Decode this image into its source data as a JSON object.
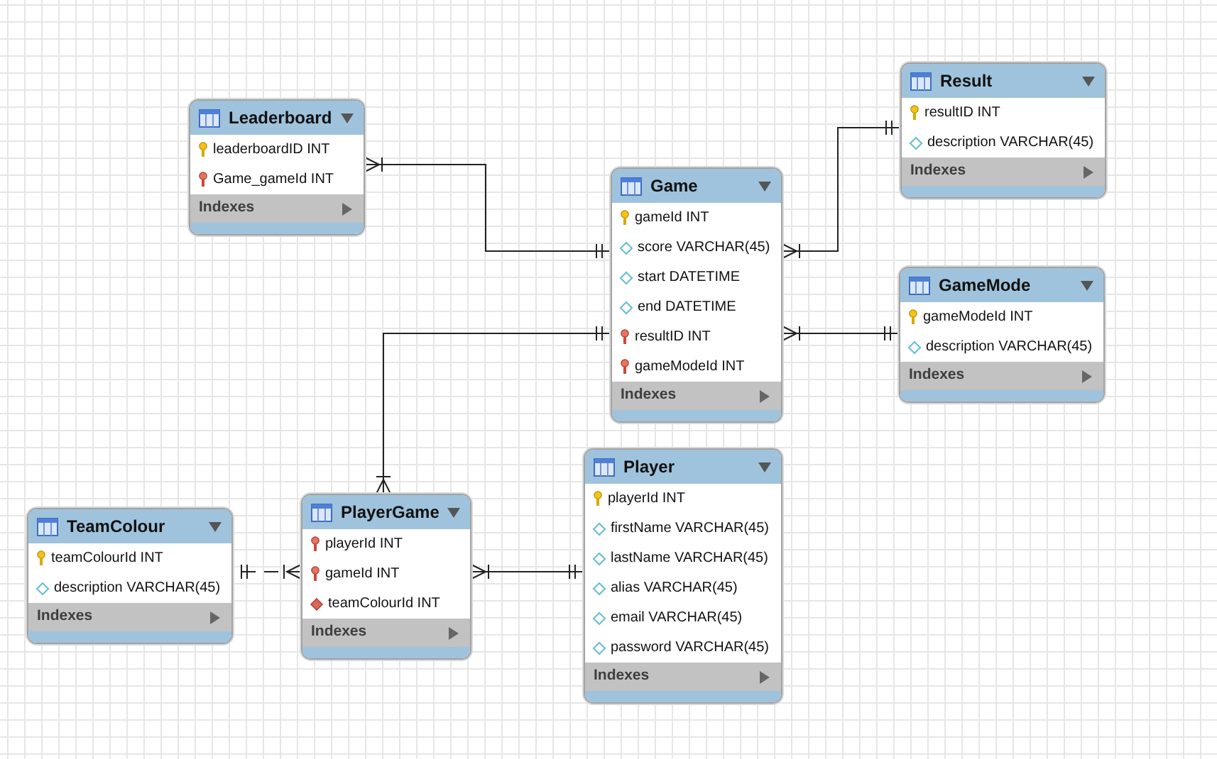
{
  "tables": [
    {
      "title": "Leaderboard",
      "columns": [
        {
          "name": "leaderboardID INT",
          "kind": "primary-key"
        },
        {
          "name": "Game_gameId INT",
          "kind": "foreign-key"
        }
      ],
      "indexes": "Indexes"
    },
    {
      "title": "Game",
      "columns": [
        {
          "name": "gameId INT",
          "kind": "primary-key"
        },
        {
          "name": "score VARCHAR(45)",
          "kind": "attribute"
        },
        {
          "name": "start DATETIME",
          "kind": "attribute"
        },
        {
          "name": "end DATETIME",
          "kind": "attribute"
        },
        {
          "name": "resultID INT",
          "kind": "foreign-key"
        },
        {
          "name": "gameModeId INT",
          "kind": "foreign-key"
        }
      ],
      "indexes": "Indexes"
    },
    {
      "title": "Result",
      "columns": [
        {
          "name": "resultID INT",
          "kind": "primary-key"
        },
        {
          "name": "description VARCHAR(45)",
          "kind": "attribute"
        }
      ],
      "indexes": "Indexes"
    },
    {
      "title": "GameMode",
      "columns": [
        {
          "name": "gameModeId INT",
          "kind": "primary-key"
        },
        {
          "name": "description VARCHAR(45)",
          "kind": "attribute"
        }
      ],
      "indexes": "Indexes"
    },
    {
      "title": "TeamColour",
      "columns": [
        {
          "name": "teamColourId INT",
          "kind": "primary-key"
        },
        {
          "name": "description VARCHAR(45)",
          "kind": "attribute"
        }
      ],
      "indexes": "Indexes"
    },
    {
      "title": "PlayerGame",
      "columns": [
        {
          "name": "playerId INT",
          "kind": "foreign-key"
        },
        {
          "name": "gameId INT",
          "kind": "foreign-key"
        },
        {
          "name": "teamColourId INT",
          "kind": "foreign-attribute"
        }
      ],
      "indexes": "Indexes"
    },
    {
      "title": "Player",
      "columns": [
        {
          "name": "playerId INT",
          "kind": "primary-key"
        },
        {
          "name": "firstName VARCHAR(45)",
          "kind": "attribute"
        },
        {
          "name": "lastName VARCHAR(45)",
          "kind": "attribute"
        },
        {
          "name": "alias VARCHAR(45)",
          "kind": "attribute"
        },
        {
          "name": "email VARCHAR(45)",
          "kind": "attribute"
        },
        {
          "name": "password VARCHAR(45)",
          "kind": "attribute"
        }
      ],
      "indexes": "Indexes"
    }
  ]
}
